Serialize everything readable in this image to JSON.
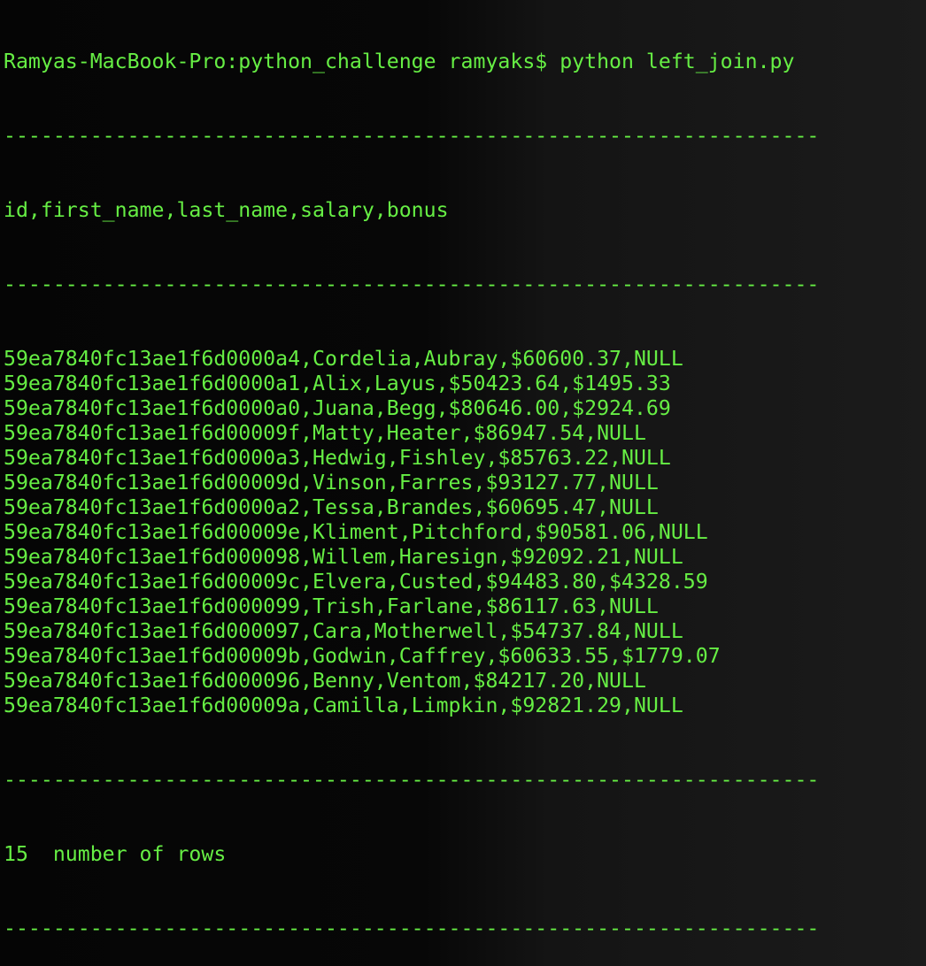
{
  "terminal": {
    "prompt": "Ramyas-MacBook-Pro:python_challenge ramyaks$ python left_join.py",
    "separator": "------------------------------------------------------------------",
    "header": "id,first_name,last_name,salary,bonus",
    "rows": [
      "59ea7840fc13ae1f6d0000a4,Cordelia,Aubray,$60600.37,NULL",
      "59ea7840fc13ae1f6d0000a1,Alix,Layus,$50423.64,$1495.33",
      "59ea7840fc13ae1f6d0000a0,Juana,Begg,$80646.00,$2924.69",
      "59ea7840fc13ae1f6d00009f,Matty,Heater,$86947.54,NULL",
      "59ea7840fc13ae1f6d0000a3,Hedwig,Fishley,$85763.22,NULL",
      "59ea7840fc13ae1f6d00009d,Vinson,Farres,$93127.77,NULL",
      "59ea7840fc13ae1f6d0000a2,Tessa,Brandes,$60695.47,NULL",
      "59ea7840fc13ae1f6d00009e,Kliment,Pitchford,$90581.06,NULL",
      "59ea7840fc13ae1f6d000098,Willem,Haresign,$92092.21,NULL",
      "59ea7840fc13ae1f6d00009c,Elvera,Custed,$94483.80,$4328.59",
      "59ea7840fc13ae1f6d000099,Trish,Farlane,$86117.63,NULL",
      "59ea7840fc13ae1f6d000097,Cara,Motherwell,$54737.84,NULL",
      "59ea7840fc13ae1f6d00009b,Godwin,Caffrey,$60633.55,$1779.07",
      "59ea7840fc13ae1f6d000096,Benny,Ventom,$84217.20,NULL",
      "59ea7840fc13ae1f6d00009a,Camilla,Limpkin,$92821.29,NULL"
    ],
    "summary": "15  number of rows",
    "text_color": "#66ee44"
  }
}
